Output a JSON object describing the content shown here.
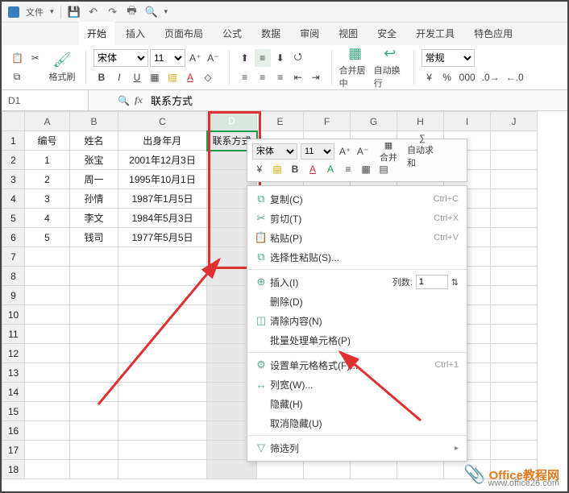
{
  "titlebar": {
    "menu_file": "文件"
  },
  "tabs": [
    "开始",
    "插入",
    "页面布局",
    "公式",
    "数据",
    "审阅",
    "视图",
    "安全",
    "开发工具",
    "特色应用"
  ],
  "active_tab": 0,
  "ribbon": {
    "format_painter": "格式刷",
    "font_name": "宋体",
    "font_size": "11",
    "merge_center": "合并居中",
    "auto_wrap": "自动换行",
    "number_format": "常规"
  },
  "namebox": "D1",
  "formula": "联系方式",
  "columns": [
    "A",
    "B",
    "C",
    "D",
    "E",
    "F",
    "G",
    "H",
    "I",
    "J"
  ],
  "headers": {
    "A": "编号",
    "B": "姓名",
    "C": "出身年月",
    "D": "联系方式"
  },
  "rows": [
    {
      "n": "1",
      "A": "1",
      "B": "张宝",
      "C": "2001年12月3日"
    },
    {
      "n": "2",
      "A": "2",
      "B": "周一",
      "C": "1995年10月1日"
    },
    {
      "n": "3",
      "A": "3",
      "B": "孙情",
      "C": "1987年1月5日"
    },
    {
      "n": "4",
      "A": "4",
      "B": "李文",
      "C": "1984年5月3日"
    },
    {
      "n": "5",
      "A": "5",
      "B": "钱司",
      "C": "1977年5月5日"
    }
  ],
  "mini": {
    "font_name": "宋体",
    "font_size": "11",
    "merge": "合并",
    "autosum": "自动求和"
  },
  "ctx": {
    "copy": "复制(C)",
    "copy_sc": "Ctrl+C",
    "cut": "剪切(T)",
    "cut_sc": "Ctrl+X",
    "paste": "粘贴(P)",
    "paste_sc": "Ctrl+V",
    "paste_special": "选择性粘贴(S)...",
    "insert": "插入(I)",
    "insert_count_lbl": "列数:",
    "insert_count_val": "1",
    "delete": "删除(D)",
    "clear": "清除内容(N)",
    "batch": "批量处理单元格(P)",
    "format_cells": "设置单元格格式(F)...",
    "format_cells_sc": "Ctrl+1",
    "col_width": "列宽(W)...",
    "hide": "隐藏(H)",
    "unhide": "取消隐藏(U)",
    "filter_col": "筛选列"
  },
  "watermark": {
    "title": "Office教程网",
    "url": "www.office26.com"
  }
}
